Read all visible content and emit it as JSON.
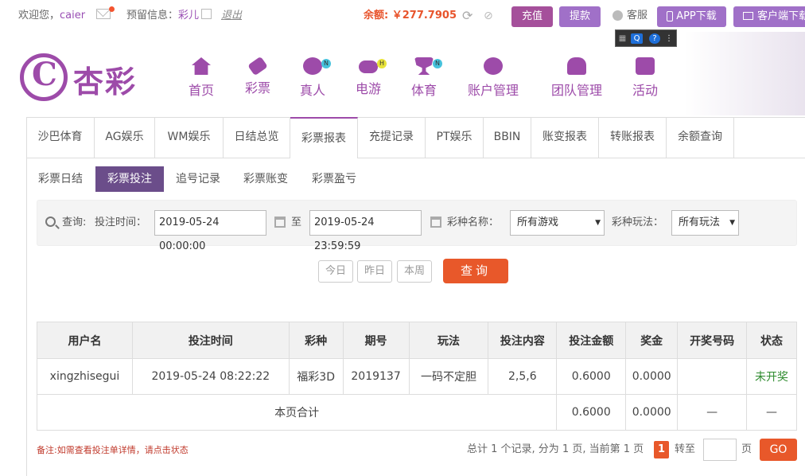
{
  "topbar": {
    "welcome": "欢迎您，",
    "username": "caier",
    "nickname_label": "预留信息：",
    "nickname": "彩儿",
    "logout": "退出",
    "balance_label": "余额:",
    "balance": "￥277.7905",
    "recharge": "充值",
    "withdraw": "提款",
    "service": "客服",
    "app_download": "APP下载",
    "client_download": "客户端下载"
  },
  "header": {
    "logo_text": "杏彩",
    "nav": [
      {
        "label": "首页",
        "icon": "home-icon"
      },
      {
        "label": "彩票",
        "icon": "lottery-ticket-icon"
      },
      {
        "label": "真人",
        "icon": "live-dealer-icon",
        "badge": "N"
      },
      {
        "label": "电游",
        "icon": "gamepad-icon",
        "badge": "H"
      },
      {
        "label": "体育",
        "icon": "trophy-icon",
        "badge": "N"
      },
      {
        "label": "账户管理",
        "icon": "yen-coin-icon"
      },
      {
        "label": "团队管理",
        "icon": "team-icon"
      },
      {
        "label": "活动",
        "icon": "gift-icon"
      }
    ]
  },
  "tabs": [
    "沙巴体育",
    "AG娱乐",
    "WM娱乐",
    "日结总览",
    "彩票报表",
    "充提记录",
    "PT娱乐",
    "BBIN",
    "账变报表",
    "转账报表",
    "余额查询"
  ],
  "subtabs": [
    "彩票日结",
    "彩票投注",
    "追号记录",
    "彩票账变",
    "彩票盈亏"
  ],
  "filter": {
    "query_label": "查询:",
    "time_label": "投注时间：",
    "start": "2019-05-24 00:00:00",
    "to": "至",
    "end": "2019-05-24 23:59:59",
    "game_label": "彩种名称：",
    "game_value": "所有游戏",
    "play_label": "彩种玩法：",
    "play_value": "所有玩法"
  },
  "quick": {
    "today": "今日",
    "yesterday": "昨日",
    "week": "本周",
    "query": "查询"
  },
  "table": {
    "headers": [
      "用户名",
      "投注时间",
      "彩种",
      "期号",
      "玩法",
      "投注内容",
      "投注金额",
      "奖金",
      "开奖号码",
      "状态"
    ],
    "rows": [
      [
        "xingzhisegui",
        "2019-05-24 08:22:22",
        "福彩3D",
        "2019137",
        "一码不定胆",
        "2,5,6",
        "0.6000",
        "0.0000",
        "",
        "未开奖"
      ]
    ],
    "subtotal_label": "本页合计",
    "subtotal_amount": "0.6000",
    "subtotal_bonus": "0.0000",
    "subtotal_draw": "—",
    "subtotal_status": "—"
  },
  "footer": {
    "note": "备注:如需查看投注单详情，请点击状态",
    "pager_text": "总计 1 个记录, 分为 1 页, 当前第 1 页",
    "current_page": "1",
    "goto": "转至",
    "page_unit": "页",
    "go": "GO"
  }
}
